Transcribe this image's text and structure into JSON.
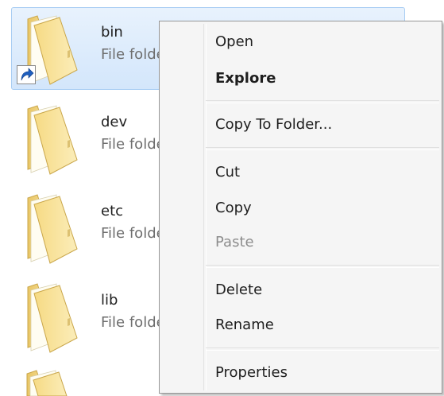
{
  "items": [
    {
      "name": "bin",
      "type": "File folder",
      "selected": true,
      "shortcut": true
    },
    {
      "name": "dev",
      "type": "File folder",
      "selected": false,
      "shortcut": false
    },
    {
      "name": "etc",
      "type": "File folder",
      "selected": false,
      "shortcut": false
    },
    {
      "name": "lib",
      "type": "File folder",
      "selected": false,
      "shortcut": false
    }
  ],
  "menu": {
    "open": "Open",
    "explore": "Explore",
    "copy_to_folder": "Copy To Folder...",
    "cut": "Cut",
    "copy": "Copy",
    "paste": "Paste",
    "delete": "Delete",
    "rename": "Rename",
    "properties": "Properties"
  },
  "colors": {
    "selection": "#d3e6fb",
    "selection_border": "#a8cdf3",
    "menu_bg": "#f5f5f5",
    "disabled_text": "#8d8d8d",
    "folder": "#f2d27a"
  },
  "icons": {
    "folder": "folder-icon",
    "shortcut": "shortcut-arrow-icon"
  }
}
